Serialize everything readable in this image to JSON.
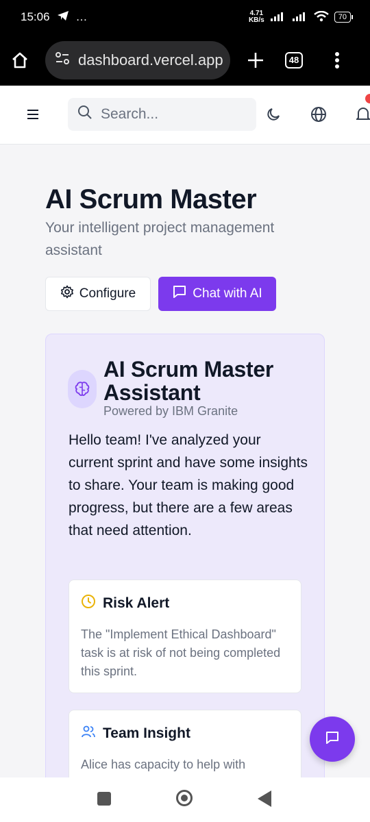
{
  "status_bar": {
    "time": "15:06",
    "more": "…",
    "net_speed_value": "4.71",
    "net_speed_unit": "KB/s",
    "battery": "70"
  },
  "browser": {
    "url": "dashboard.vercel.app",
    "tab_count": "48"
  },
  "header": {
    "search_placeholder": "Search..."
  },
  "page": {
    "title": "AI Scrum Master",
    "subtitle": "Your intelligent project management assistant",
    "configure_label": "Configure",
    "chat_label": "Chat with AI"
  },
  "assistant_card": {
    "title_line1": "AI Scrum Master",
    "title_line2": "Assistant",
    "subtitle": "Powered by IBM Granite",
    "message": "Hello team! I've analyzed your current sprint and have some insights to share. Your team is making good progress, but there are a few areas that need attention.",
    "insights": [
      {
        "title": "Risk Alert",
        "body": "The \"Implement Ethical Dashboard\" task is at risk of not being completed this sprint.",
        "icon": "clock-icon",
        "color": "#eab308"
      },
      {
        "title": "Team Insight",
        "body": "Alice has capacity to help with",
        "icon": "users-icon",
        "color": "#3b82f6"
      }
    ]
  },
  "colors": {
    "accent": "#7c3aed",
    "card_bg": "#ede9fb",
    "notification": "#ef4444"
  }
}
